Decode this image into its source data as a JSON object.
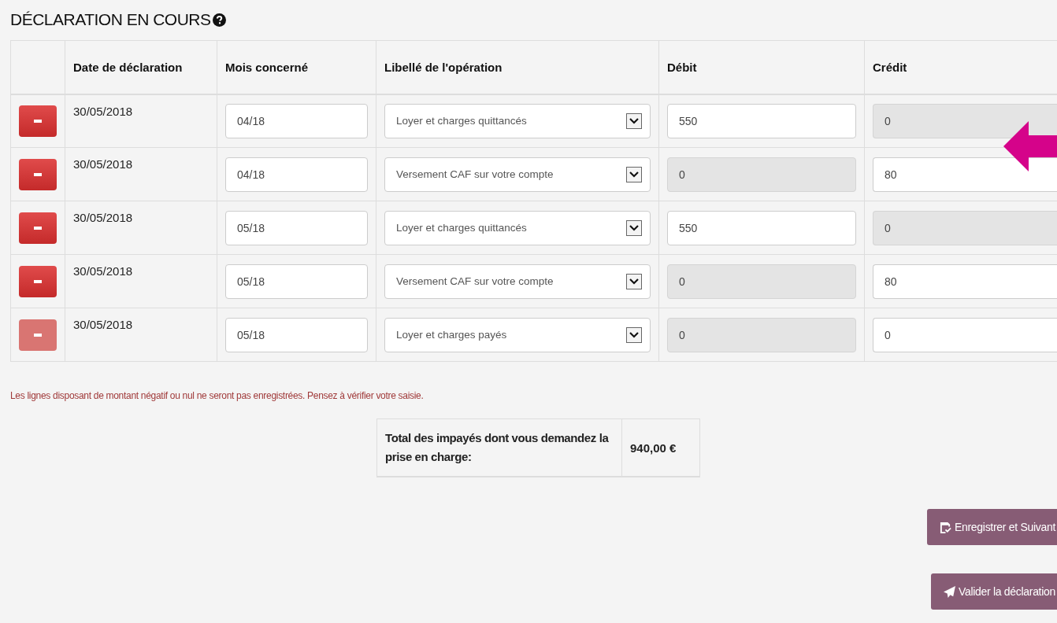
{
  "title": "DÉCLARATION EN COURS",
  "columns": [
    "Date de déclaration",
    "Mois concerné",
    "Libellé de l'opération",
    "Débit",
    "Crédit"
  ],
  "rows": [
    {
      "date": "30/05/2018",
      "month": "04/18",
      "label": "Loyer et charges quittancés",
      "debit": "550",
      "credit": "0",
      "debit_disabled": false,
      "credit_disabled": true,
      "remove_disabled": false
    },
    {
      "date": "30/05/2018",
      "month": "04/18",
      "label": "Versement CAF sur votre compte",
      "debit": "0",
      "credit": "80",
      "debit_disabled": true,
      "credit_disabled": false,
      "remove_disabled": false
    },
    {
      "date": "30/05/2018",
      "month": "05/18",
      "label": "Loyer et charges quittancés",
      "debit": "550",
      "credit": "0",
      "debit_disabled": false,
      "credit_disabled": true,
      "remove_disabled": false
    },
    {
      "date": "30/05/2018",
      "month": "05/18",
      "label": "Versement CAF sur votre compte",
      "debit": "0",
      "credit": "80",
      "debit_disabled": true,
      "credit_disabled": false,
      "remove_disabled": false
    },
    {
      "date": "30/05/2018",
      "month": "05/18",
      "label": "Loyer et charges payés",
      "debit": "0",
      "credit": "0",
      "debit_disabled": true,
      "credit_disabled": false,
      "remove_disabled": true
    }
  ],
  "notice": "Les lignes disposant de montant négatif ou nul ne seront pas enregistrées. Pensez à  vérifier votre saisie.",
  "total": {
    "label": "Total des impayés dont vous demandez la prise en charge:",
    "amount": "940,00 €"
  },
  "buttons": [
    {
      "kind": "save",
      "label": "Enregistrer et Suivant"
    },
    {
      "kind": "send",
      "label": "Valider la déclaration"
    }
  ]
}
